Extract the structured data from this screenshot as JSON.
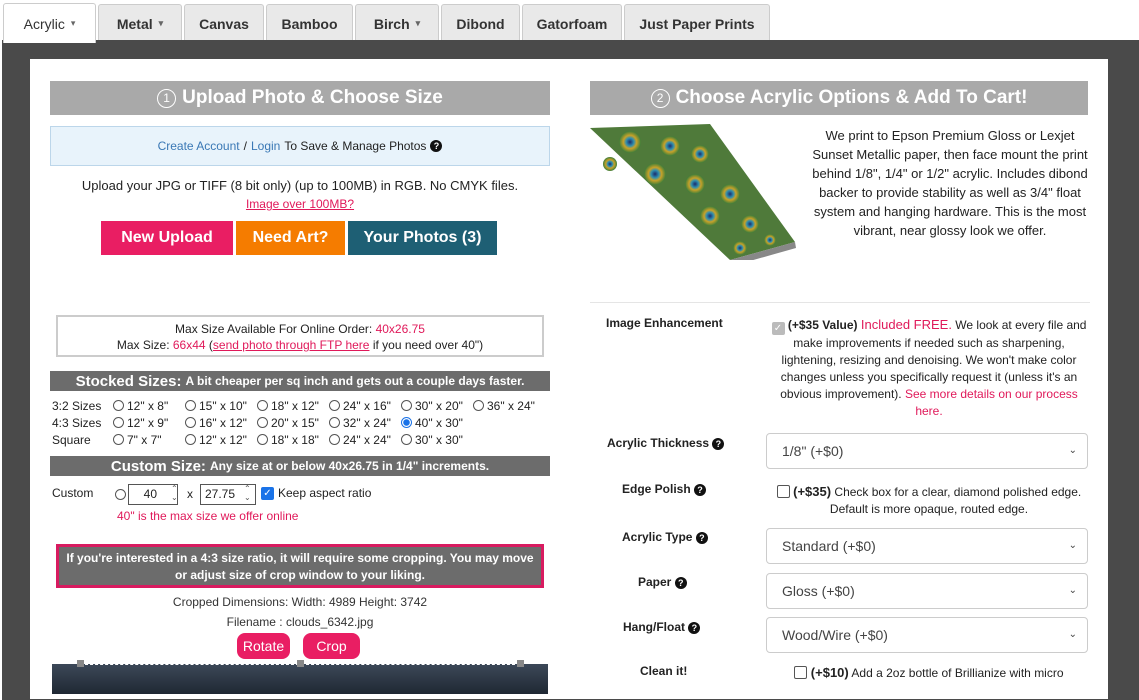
{
  "tabs": [
    {
      "label": "Acrylic",
      "caret": "▾"
    },
    {
      "label": "Metal",
      "caret": "▾"
    },
    {
      "label": "Canvas",
      "caret": ""
    },
    {
      "label": "Bamboo",
      "caret": ""
    },
    {
      "label": "Birch",
      "caret": "▾"
    },
    {
      "label": "Dibond",
      "caret": ""
    },
    {
      "label": "Gatorfoam",
      "caret": ""
    },
    {
      "label": "Just Paper Prints",
      "caret": ""
    }
  ],
  "left": {
    "step_num": "1",
    "header": "Upload Photo & Choose Size",
    "account": {
      "create": "Create Account",
      "sep": "/",
      "login": "Login",
      "suffix": "To Save & Manage Photos"
    },
    "upload_info": "Upload your JPG or TIFF (8 bit only) (up to 100MB) in RGB. No CMYK files.",
    "over_link": "Image over 100MB?",
    "buttons": {
      "new_upload": "New Upload",
      "need_art": "Need Art?",
      "your_photos": "Your Photos (3)"
    },
    "max": {
      "line1_prefix": "Max Size Available For Online Order:",
      "line1_value": "40x26.75",
      "line2_prefix": "Max Size:",
      "line2_value": "66x44",
      "line2_paren_open": "(",
      "line2_link": "send photo through FTP here",
      "line2_suffix": "if you need over 40\")"
    },
    "stocked": {
      "title": "Stocked Sizes:",
      "subtitle": "A bit cheaper per sq inch and gets out a couple days faster."
    },
    "rows": [
      {
        "label": "3:2 Sizes",
        "options": [
          "12\" x 8\"",
          "15\" x 10\"",
          "18\" x 12\"",
          "24\" x 16\"",
          "30\" x 20\"",
          "36\" x 24\""
        ]
      },
      {
        "label": "4:3 Sizes",
        "options": [
          "12\" x 9\"",
          "16\" x 12\"",
          "20\" x 15\"",
          "32\" x 24\"",
          "40\" x 30\""
        ]
      },
      {
        "label": "Square",
        "options": [
          "7\" x 7\"",
          "12\" x 12\"",
          "18\" x 18\"",
          "24\" x 24\"",
          "30\" x 30\""
        ]
      }
    ],
    "selected_size": "40\" x 30\"",
    "custom": {
      "title": "Custom Size:",
      "subtitle": "Any size at or below 40x26.75 in 1/4\" increments.",
      "label": "Custom",
      "width": "40",
      "times": "x",
      "height": "27.75",
      "keep_aspect": "Keep aspect ratio",
      "keep_aspect_checked": true,
      "max_note": "40\" is the max size we offer online"
    },
    "notice": "If you're interested in a 4:3 size ratio, it will require some cropping. You may move or adjust size of crop window to your liking.",
    "cropped": "Cropped Dimensions:  Width:  4989  Height:  3742",
    "filename": "Filename : clouds_6342.jpg",
    "rotate": "Rotate",
    "crop": "Crop"
  },
  "right": {
    "step_num": "2",
    "header": "Choose Acrylic Options & Add To Cart!",
    "description": "We print to Epson Premium Gloss or Lexjet Sunset Metallic paper, then face mount the print behind 1/8\", 1/4\" or 1/2\" acrylic. Includes dibond backer to provide stability as well as 3/4\" float system and hanging hardware. This is the most vibrant, near glossy look we offer.",
    "enhancement": {
      "label": "Image Enhancement",
      "value": "(+$35 Value)",
      "free": "Included FREE.",
      "text": "We look at every file and make improvements if needed such as sharpening, lightening, resizing and denoising. We won't make color changes unless you specifically request it (unless it's an obvious improvement).",
      "link": "See more details on our process here."
    },
    "thickness": {
      "label": "Acrylic Thickness",
      "value": "1/8\" (+$0)"
    },
    "edge": {
      "label": "Edge Polish",
      "price": "(+$35)",
      "text": "Check box for a clear, diamond polished edge. Default is more opaque, routed edge."
    },
    "type": {
      "label": "Acrylic Type",
      "value": "Standard (+$0)"
    },
    "paper": {
      "label": "Paper",
      "value": "Gloss (+$0)"
    },
    "hang": {
      "label": "Hang/Float",
      "value": "Wood/Wire (+$0)"
    },
    "clean": {
      "label": "Clean it!",
      "price": "(+$10)",
      "text": "Add a 2oz bottle of Brillianize with micro"
    }
  },
  "icons": {
    "question": "?",
    "check": "✓",
    "up": "⌃",
    "down": "⌄",
    "dropdown": "⌄"
  },
  "colors": {
    "pink": "#e91e63",
    "orange": "#f57c00",
    "teal": "#1e5f74",
    "grey_header": "#a9a9a9",
    "red_text": "#e0195a"
  }
}
